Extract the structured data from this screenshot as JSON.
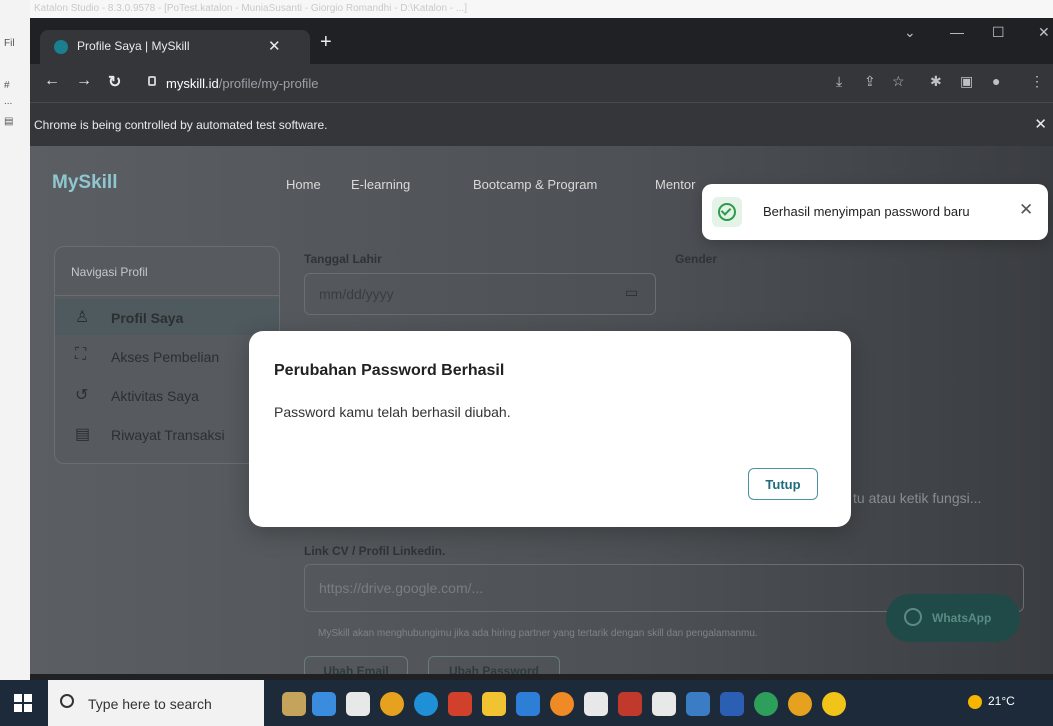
{
  "background": {
    "ghost_title": "Katalon Studio - 8.3.0.9578 - [PoTest.katalon - MuniaSusanti - Giorgio Romandhi - D:\\Katalon - ...]",
    "left_strip": [
      "Fil",
      "#",
      "...",
      "▤"
    ]
  },
  "browser": {
    "tab_title": "Profile Saya | MySkill",
    "url_host": "myskill.id",
    "url_path": "/profile/my-profile",
    "infobar_message": "Chrome is being controlled by automated test software."
  },
  "page": {
    "logo": "MySkill",
    "topnav": [
      "Home",
      "E-learning",
      "Bootcamp & Program",
      "Mentor"
    ],
    "sidebar": {
      "heading": "Navigasi Profil",
      "items": [
        {
          "label": "Profil Saya",
          "icon": "user-icon"
        },
        {
          "label": "Akses Pembelian",
          "icon": "bag-icon"
        },
        {
          "label": "Aktivitas Saya",
          "icon": "history-icon"
        },
        {
          "label": "Riwayat Transaksi",
          "icon": "receipt-icon"
        }
      ]
    },
    "form": {
      "tanggal_lahir_label": "Tanggal Lahir",
      "tanggal_lahir_placeholder": "mm/dd/yyyy",
      "gender_label": "Gender",
      "partial_text": "tu atau ketik fungsi...",
      "linkcv_label": "Link CV / Profil Linkedin.",
      "linkcv_placeholder": "https://drive.google.com/...",
      "hint": "MySkill akan menghubungimu jika ada hiring partner yang tertarik dengan skill dan pengalamanmu.",
      "ubah_email": "Ubah Email",
      "ubah_password": "Ubah Password"
    },
    "whatsapp_label": "WhatsApp"
  },
  "modal": {
    "title": "Perubahan Password Berhasil",
    "body": "Password kamu telah berhasil diubah.",
    "button": "Tutup"
  },
  "toast": {
    "message": "Berhasil menyimpan password baru"
  },
  "taskbar": {
    "search_placeholder": "Type here to search",
    "temperature": "21°C"
  }
}
